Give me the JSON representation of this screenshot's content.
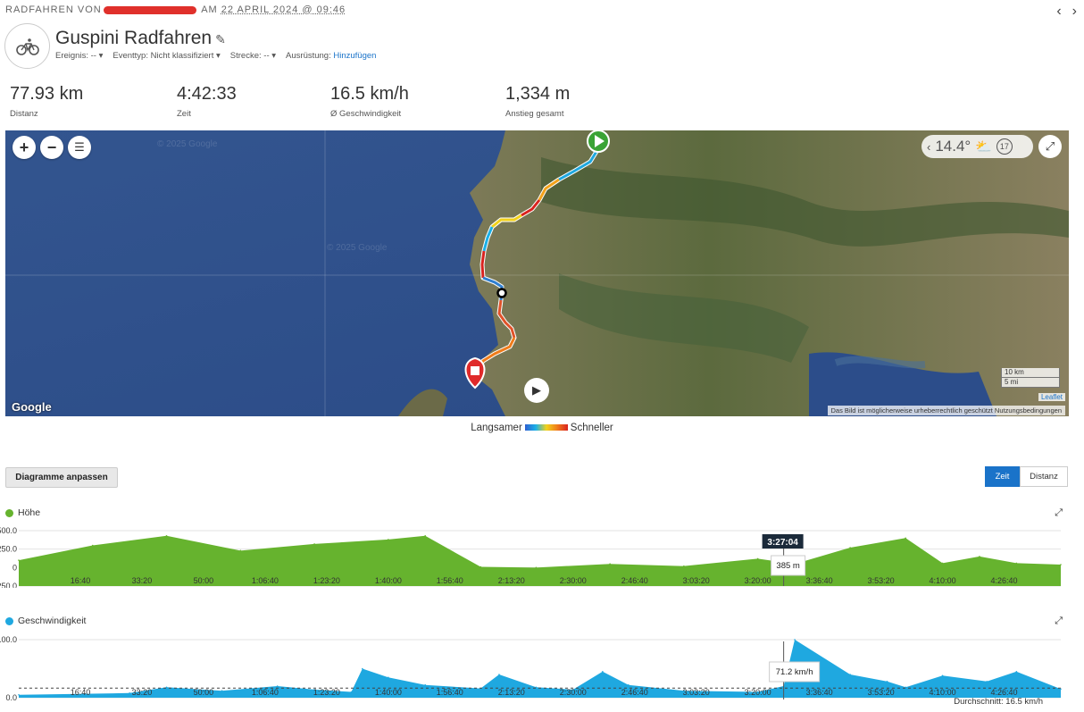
{
  "header": {
    "activity_type": "RADFAHREN",
    "by_prefix": "VON",
    "date_prefix": "AM",
    "date": "22 APRIL 2024 @ 09:46",
    "title": "Guspini Radfahren",
    "meta": {
      "event_label": "Ereignis:",
      "event_value": "--",
      "eventtype_label": "Eventtyp:",
      "eventtype_value": "Nicht klassifiziert",
      "course_label": "Strecke:",
      "course_value": "--",
      "gear_label": "Ausrüstung:",
      "gear_link": "Hinzufügen"
    }
  },
  "stats": [
    {
      "value": "77.93 km",
      "label": "Distanz"
    },
    {
      "value": "4:42:33",
      "label": "Zeit"
    },
    {
      "value": "16.5 km/h",
      "label": "Ø Geschwindigkeit"
    },
    {
      "value": "1,334 m",
      "label": "Anstieg gesamt"
    }
  ],
  "map": {
    "weather_temp": "14.4°",
    "weather_wind": "17",
    "watermark1": "© 2025 Google",
    "watermark2": "© 2025 Google",
    "google": "Google",
    "scale_km": "10 km",
    "scale_mi": "5 mi",
    "leaflet": "Leaflet",
    "attribution": "Das Bild ist möglicherweise urheberrechtlich geschützt    Nutzungsbedingungen",
    "colors": {
      "sea": "#3a5a9a",
      "land": "#6f7a52",
      "start": "#3aa335",
      "end": "#e02a2a"
    }
  },
  "legend": {
    "slow": "Langsamer",
    "fast": "Schneller"
  },
  "controls": {
    "adjust_charts": "Diagramme anpassen",
    "toggle_time": "Zeit",
    "toggle_distance": "Distanz"
  },
  "chart_data": [
    {
      "type": "area",
      "title": "Höhe",
      "color": "#66b32e",
      "yticks": [
        "500.0",
        "250.0",
        "0",
        "-250.0"
      ],
      "ylim": [
        -250,
        500
      ],
      "xticks": [
        "16:40",
        "33:20",
        "50:00",
        "1:06:40",
        "1:23:20",
        "1:40:00",
        "1:56:40",
        "2:13:20",
        "2:30:00",
        "2:46:40",
        "3:03:20",
        "3:20:00",
        "3:36:40",
        "3:53:20",
        "4:10:00",
        "4:26:40"
      ],
      "x_minutes": [
        0,
        20,
        40,
        60,
        80,
        100,
        110,
        125,
        140,
        160,
        180,
        200,
        210,
        225,
        240,
        250,
        260,
        270,
        282
      ],
      "values": [
        100,
        300,
        430,
        230,
        320,
        380,
        430,
        10,
        0,
        50,
        20,
        120,
        50,
        270,
        400,
        60,
        150,
        60,
        40
      ],
      "tooltip_time": "3:27:04",
      "tooltip_value": "385 m"
    },
    {
      "type": "area",
      "title": "Geschwindigkeit",
      "color": "#1fa8e0",
      "yticks": [
        "100.0",
        "0.0"
      ],
      "ylim": [
        0,
        100
      ],
      "xticks": [
        "16:40",
        "33:20",
        "50:00",
        "1:06:40",
        "1:23:20",
        "1:40:00",
        "1:56:40",
        "2:13:20",
        "2:30:00",
        "2:46:40",
        "3:03:20",
        "3:20:00",
        "3:36:40",
        "3:53:20",
        "4:10:00",
        "4:26:40"
      ],
      "x_minutes": [
        0,
        30,
        40,
        55,
        70,
        80,
        90,
        93,
        100,
        110,
        125,
        130,
        140,
        150,
        158,
        165,
        180,
        200,
        207,
        210,
        225,
        235,
        240,
        250,
        262,
        270,
        282
      ],
      "values": [
        5,
        8,
        18,
        12,
        20,
        14,
        10,
        50,
        35,
        22,
        16,
        40,
        18,
        14,
        45,
        22,
        12,
        10,
        20,
        100,
        40,
        28,
        18,
        38,
        28,
        45,
        15
      ],
      "average": 16.5,
      "average_label": "Durchschnitt: 16.5 km/h",
      "tooltip_value": "71.2 km/h"
    }
  ]
}
